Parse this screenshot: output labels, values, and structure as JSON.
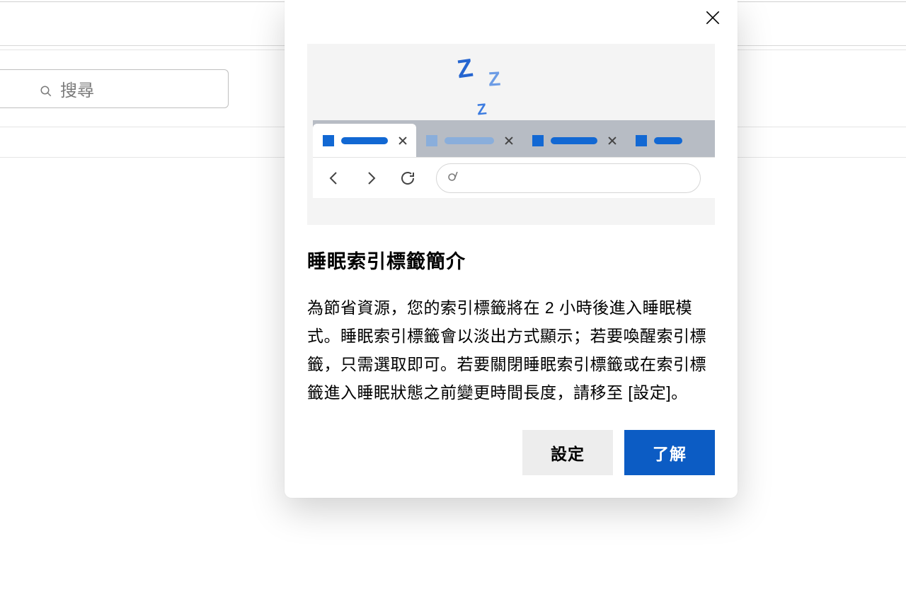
{
  "background": {
    "search_placeholder": "搜尋"
  },
  "dialog": {
    "title": "睡眠索引標籤簡介",
    "body": "為節省資源，您的索引標籤將在 2 小時後進入睡眠模式。睡眠索引標籤會以淡出方式顯示；若要喚醒索引標籤，只需選取即可。若要關閉睡眠索引標籤或在索引標籤進入睡眠狀態之前變更時間長度，請移至 [設定]。",
    "buttons": {
      "settings": "設定",
      "ok": "了解"
    },
    "illustration": {
      "z_icons": [
        "Z",
        "Z",
        "Z"
      ]
    }
  }
}
